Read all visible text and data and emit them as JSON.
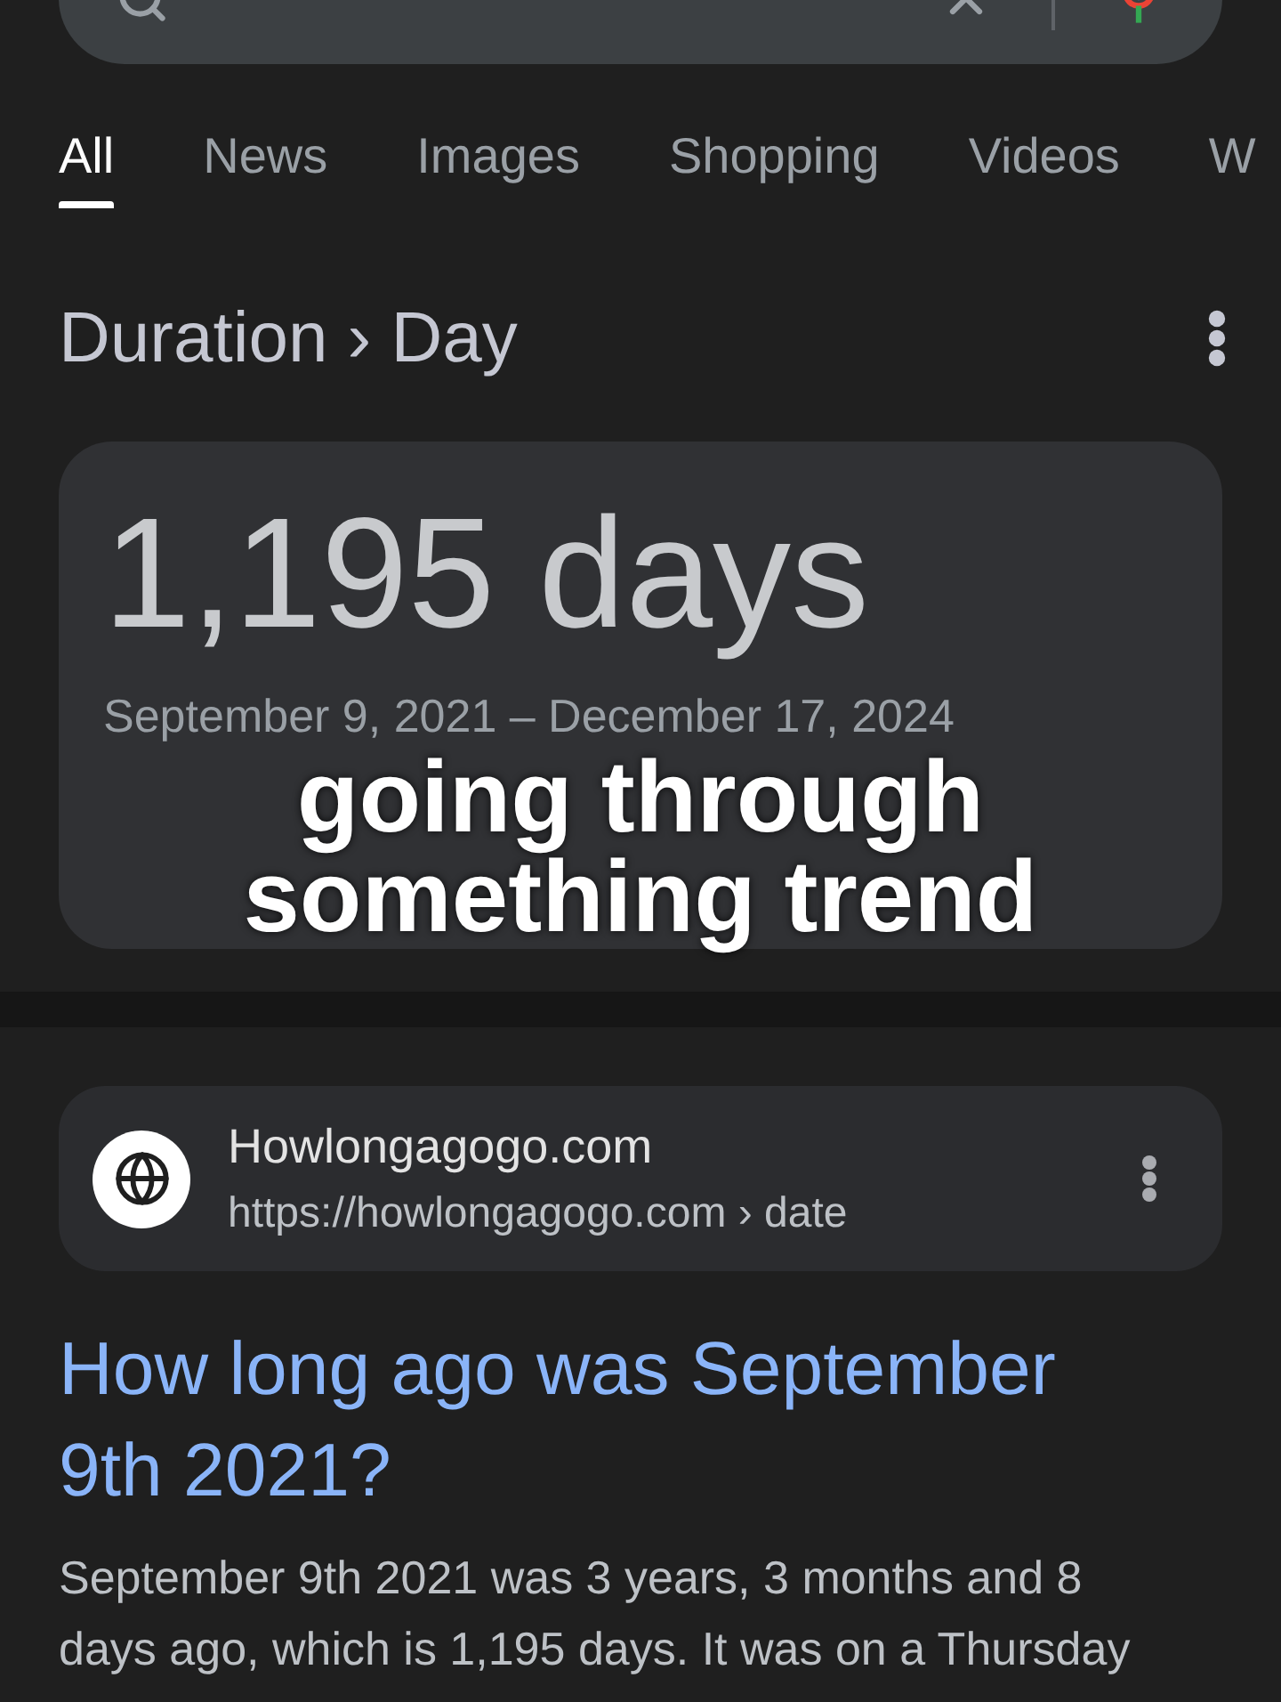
{
  "tabs": [
    {
      "label": "All",
      "selected": true
    },
    {
      "label": "News",
      "selected": false
    },
    {
      "label": "Images",
      "selected": false
    },
    {
      "label": "Shopping",
      "selected": false
    },
    {
      "label": "Videos",
      "selected": false
    },
    {
      "label": "W",
      "selected": false
    }
  ],
  "breadcrumb": "Duration › Day",
  "answer_card": {
    "value": "1,195 days",
    "date_range": "September 9, 2021 – December 17, 2024"
  },
  "overlay_caption": "going through something trend",
  "result": {
    "site_name": "Howlongagogo.com",
    "url": "https://howlongagogo.com › date",
    "title": "How long ago was September 9th 2021?",
    "snippet": "September 9th 2021 was 3 years, 3 months and 8 days ago, which is 1,195 days. It was on a Thursday"
  }
}
